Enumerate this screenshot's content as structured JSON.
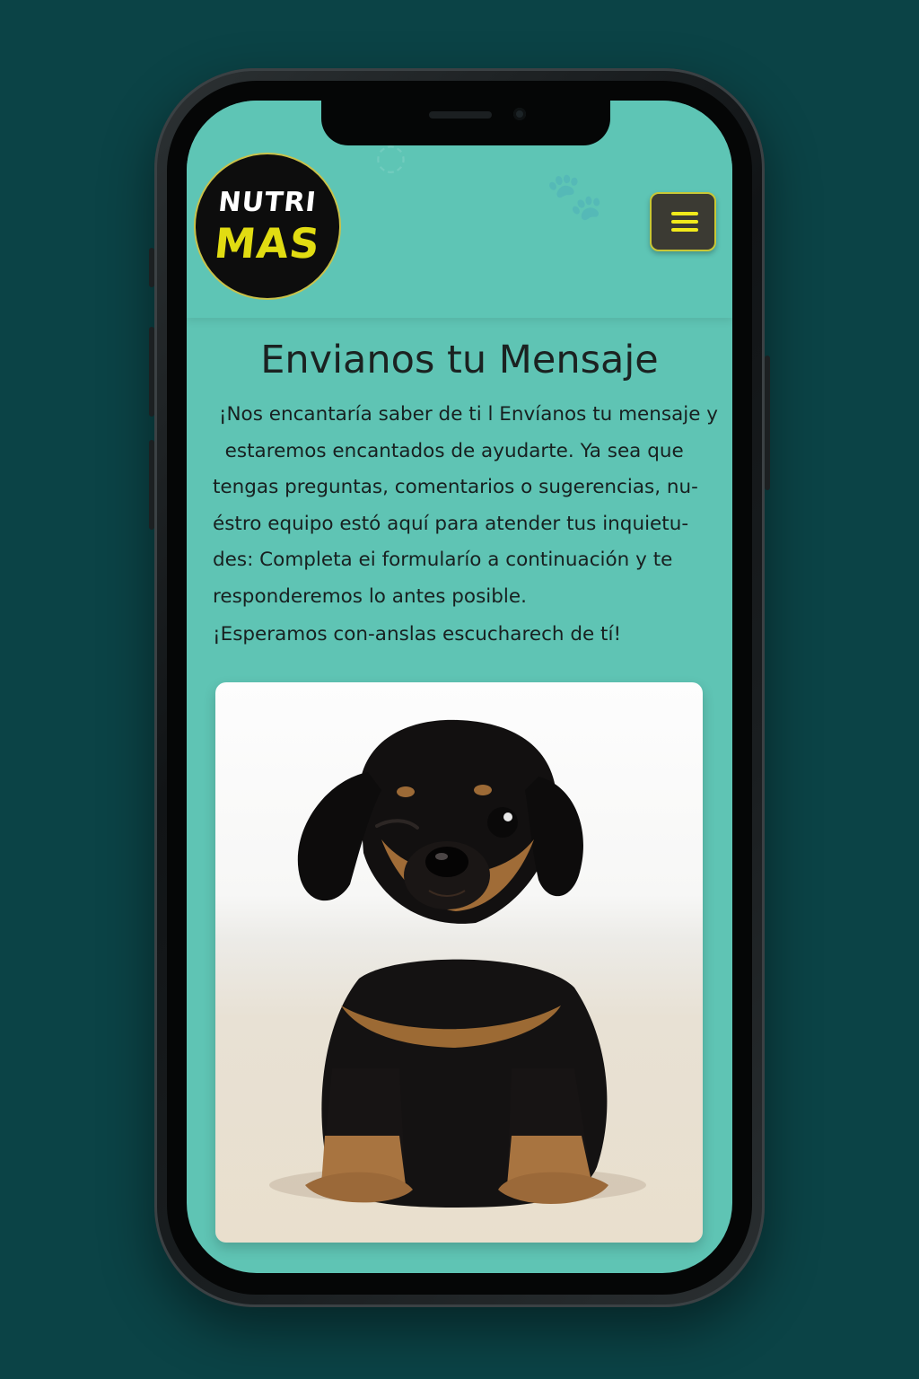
{
  "brand": {
    "logo_top": "NUTRI",
    "logo_bottom": "MAS",
    "logo_colors": {
      "background": "#0d0d0d",
      "top_text": "#ffffff",
      "bottom_text": "#e1dc12"
    }
  },
  "header": {
    "menu_icon": "hamburger-menu-icon",
    "menu_colors": {
      "background": "#3b3a33",
      "lines": "#f1ea1b"
    },
    "background_color": "#5ec5b5"
  },
  "main": {
    "title": "Envianos tu Mensaje",
    "paragraph_lines": [
      " ¡Nos encantaría saber de ti l Envíanos tu mensaje y",
      "  estaremos encantados de ayudarte. Ya sea que",
      "tengas preguntas, comentarios o sugerencias, nu-",
      "éstro equipo estó aquí para atender tus inquietu-",
      "des: Completa ei formularío a continuación y te",
      "responderemos lo antes posible."
    ],
    "closing": "¡Esperamos con-anslas escucharech de tí!",
    "image": "puppy-photo"
  },
  "colors": {
    "page_background": "#0b4346",
    "screen_background": "#5fc4b4",
    "text": "#182020"
  }
}
